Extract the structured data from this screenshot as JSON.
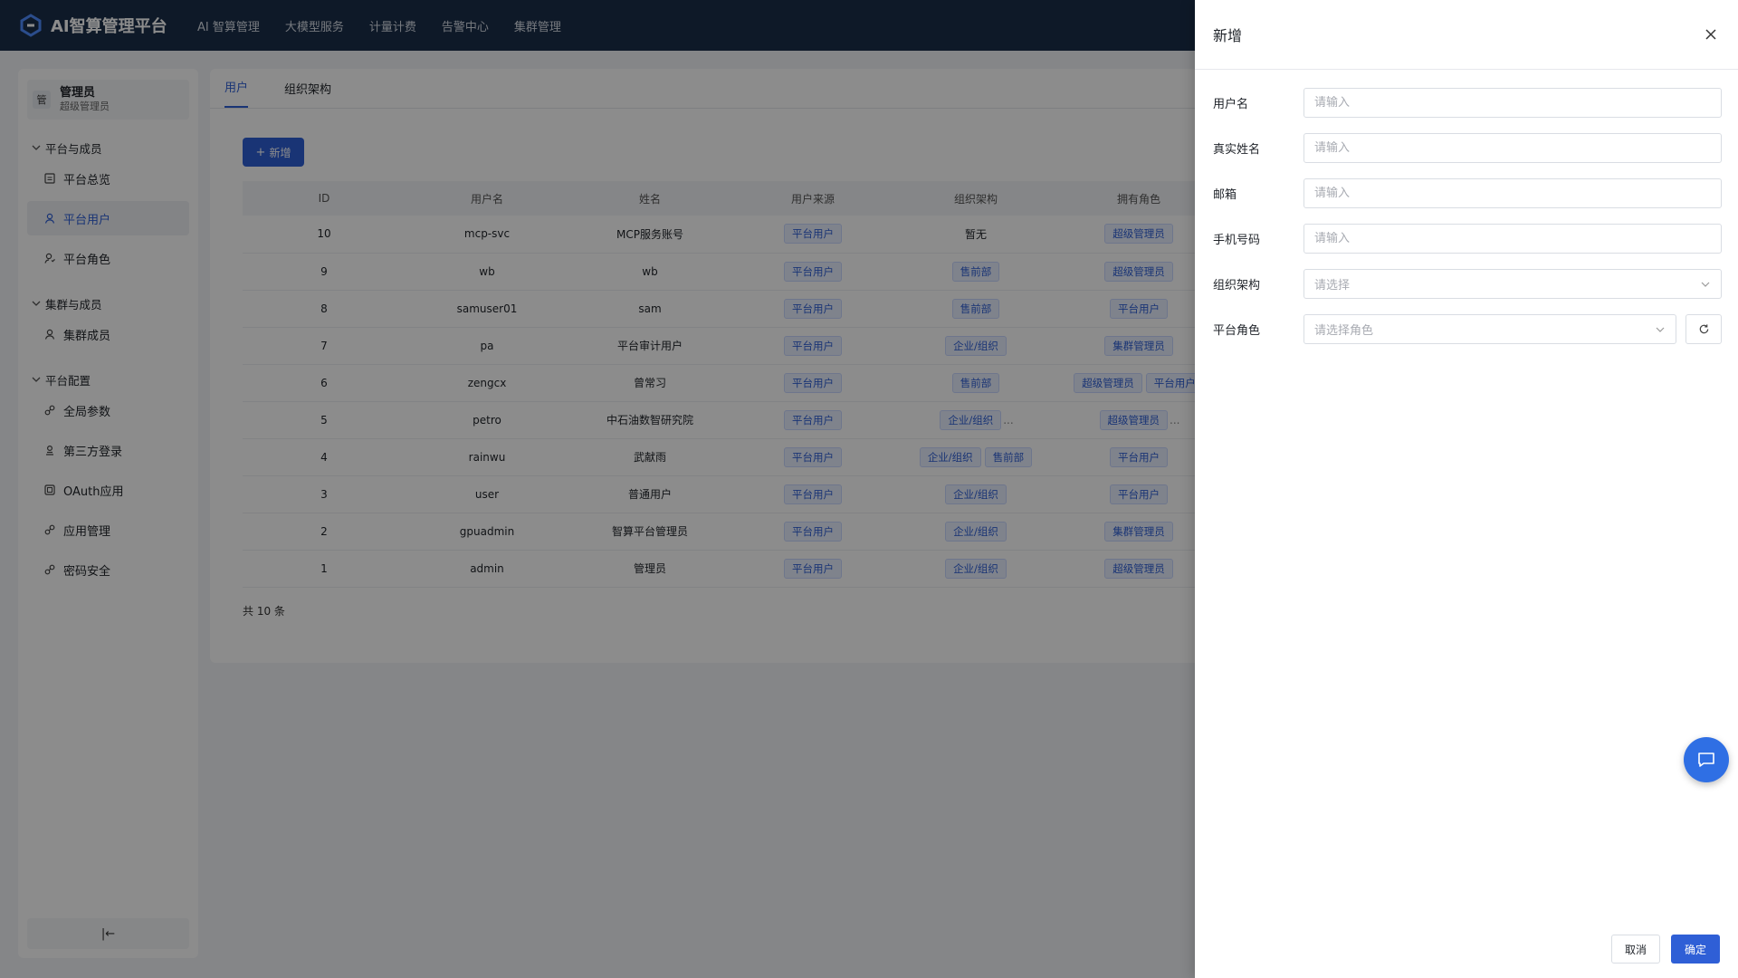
{
  "app": {
    "title": "AI智算管理平台"
  },
  "topnav": {
    "items": [
      "AI 智算管理",
      "大模型服务",
      "计量计费",
      "告警中心",
      "集群管理"
    ]
  },
  "sidebar": {
    "user": {
      "avatar": "管",
      "name": "管理员",
      "role": "超级管理员"
    },
    "groups": [
      {
        "title": "平台与成员",
        "items": [
          {
            "label": "平台总览",
            "icon": "dashboard-icon"
          },
          {
            "label": "平台用户",
            "icon": "user-icon",
            "active": true
          },
          {
            "label": "平台角色",
            "icon": "role-icon"
          }
        ]
      },
      {
        "title": "集群与成员",
        "items": [
          {
            "label": "集群成员",
            "icon": "user-icon"
          }
        ]
      },
      {
        "title": "平台配置",
        "items": [
          {
            "label": "全局参数",
            "icon": "link-icon"
          },
          {
            "label": "第三方登录",
            "icon": "login-icon"
          },
          {
            "label": "OAuth应用",
            "icon": "app-icon"
          },
          {
            "label": "应用管理",
            "icon": "link-icon"
          },
          {
            "label": "密码安全",
            "icon": "link-icon"
          }
        ]
      }
    ],
    "collapse_icon": "|←"
  },
  "tabs": [
    "用户",
    "组织架构"
  ],
  "toolbar": {
    "add_label": "新增",
    "add_icon": "+"
  },
  "table": {
    "headers": [
      "ID",
      "用户名",
      "姓名",
      "用户来源",
      "组织架构",
      "拥有角色"
    ],
    "rows": [
      {
        "id": "10",
        "username": "mcp-svc",
        "name": "MCP服务账号",
        "source": "平台用户",
        "org": [
          "暂无"
        ],
        "org_plain": true,
        "roles": [
          "超级管理员"
        ]
      },
      {
        "id": "9",
        "username": "wb",
        "name": "wb",
        "source": "平台用户",
        "org": [
          "售前部"
        ],
        "roles": [
          "超级管理员"
        ]
      },
      {
        "id": "8",
        "username": "samuser01",
        "name": "sam",
        "source": "平台用户",
        "org": [
          "售前部"
        ],
        "roles": [
          "平台用户"
        ]
      },
      {
        "id": "7",
        "username": "pa",
        "name": "平台审计用户",
        "source": "平台用户",
        "org": [
          "企业/组织"
        ],
        "roles": [
          "集群管理员"
        ]
      },
      {
        "id": "6",
        "username": "zengcx",
        "name": "曾常习",
        "source": "平台用户",
        "org": [
          "售前部"
        ],
        "roles": [
          "超级管理员",
          "平台用户"
        ]
      },
      {
        "id": "5",
        "username": "petro",
        "name": "中石油数智研究院",
        "source": "平台用户",
        "org": [
          "企业/组织"
        ],
        "org_more": "...",
        "roles": [
          "超级管理员"
        ],
        "roles_more": "..."
      },
      {
        "id": "4",
        "username": "rainwu",
        "name": "武献雨",
        "source": "平台用户",
        "org": [
          "企业/组织",
          "售前部"
        ],
        "roles": [
          "平台用户"
        ]
      },
      {
        "id": "3",
        "username": "user",
        "name": "普通用户",
        "source": "平台用户",
        "org": [
          "企业/组织"
        ],
        "roles": [
          "平台用户"
        ]
      },
      {
        "id": "2",
        "username": "gpuadmin",
        "name": "智算平台管理员",
        "source": "平台用户",
        "org": [
          "企业/组织"
        ],
        "roles": [
          "集群管理员"
        ]
      },
      {
        "id": "1",
        "username": "admin",
        "name": "管理员",
        "source": "平台用户",
        "org": [
          "企业/组织"
        ],
        "roles": [
          "超级管理员"
        ]
      }
    ],
    "total": "共 10 条"
  },
  "drawer": {
    "title": "新增",
    "fields": [
      {
        "label": "用户名",
        "placeholder": "请输入",
        "type": "input"
      },
      {
        "label": "真实姓名",
        "placeholder": "请输入",
        "type": "input"
      },
      {
        "label": "邮箱",
        "placeholder": "请输入",
        "type": "input"
      },
      {
        "label": "手机号码",
        "placeholder": "请输入",
        "type": "input"
      },
      {
        "label": "组织架构",
        "placeholder": "请选择",
        "type": "select"
      },
      {
        "label": "平台角色",
        "placeholder": "请选择角色",
        "type": "select-refresh"
      }
    ],
    "cancel_label": "取消",
    "ok_label": "确定"
  },
  "colors": {
    "topbar": "#1b2e4a",
    "accent": "#2f5fd6",
    "tag_bg": "#e8efff",
    "fab": "#2f6fe4"
  }
}
